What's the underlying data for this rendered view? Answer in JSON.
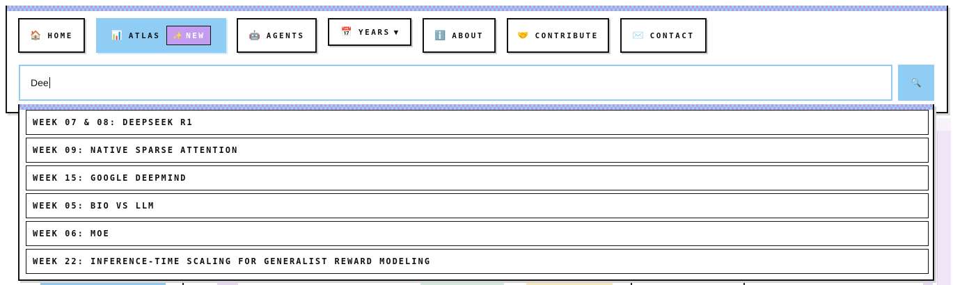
{
  "nav": {
    "home": {
      "icon": "🏠",
      "icon_name": "house-icon",
      "label": "Home"
    },
    "atlas": {
      "icon": "📊",
      "icon_name": "bar-chart-icon",
      "label": "Atlas",
      "badge_icon": "✨",
      "badge_icon_name": "sparkles-icon",
      "badge_label": "New"
    },
    "agents": {
      "icon": "🤖",
      "icon_name": "robot-icon",
      "label": "Agents"
    },
    "years": {
      "icon": "📅",
      "icon_name": "calendar-icon",
      "label": "Years",
      "caret": "▼"
    },
    "about": {
      "icon": "ℹ️",
      "icon_name": "info-icon",
      "label": "About"
    },
    "contribute": {
      "icon": "🤝",
      "icon_name": "handshake-icon",
      "label": "Contribute"
    },
    "contact": {
      "icon": "✉️",
      "icon_name": "envelope-icon",
      "label": "Contact"
    }
  },
  "search": {
    "value": "Dee",
    "button_icon": "🔍",
    "button_icon_name": "magnifier-icon"
  },
  "results": [
    "Week 07 & 08: DeepSeek R1",
    "Week 09: Native Sparse Attention",
    "Week 15: Google DeepMind",
    "Week 05: Bio vs LLM",
    "Week 06: MoE",
    "Week 22: Inference-Time Scaling for Generalist Reward Modeling"
  ],
  "colors": {
    "accent_blue": "#8fcdf5",
    "accent_purple": "#c49cf0",
    "border": "#111111"
  }
}
